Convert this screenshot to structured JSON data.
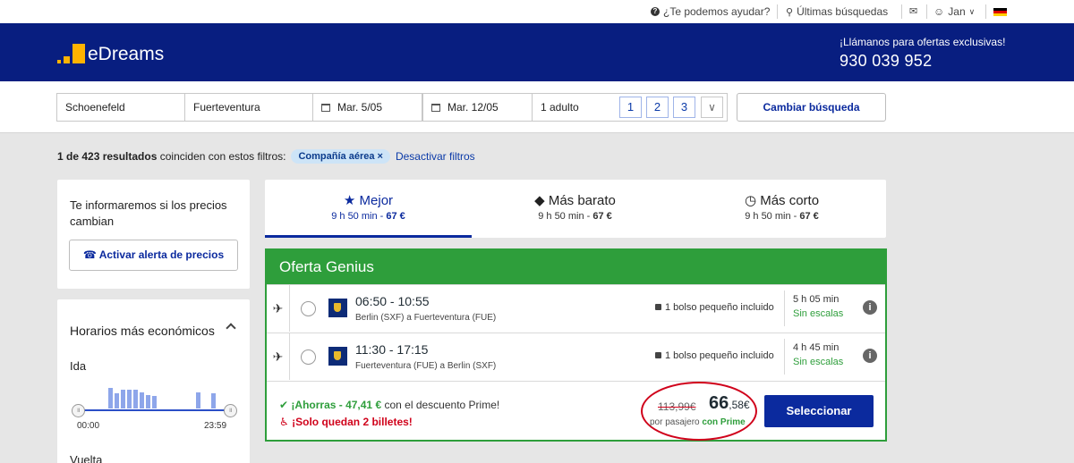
{
  "topbar": {
    "help": "¿Te podemos ayudar?",
    "recent": "Últimas búsquedas",
    "user": "Jan"
  },
  "header": {
    "logo_text": "eDreams",
    "call_line": "¡Llámanos para ofertas exclusivas!",
    "phone": "930 039 952"
  },
  "search": {
    "origin": "Schoenefeld",
    "destination": "Fuerteventura",
    "depart_date": "Mar. 5/05",
    "return_date": "Mar. 12/05",
    "passengers": "1 adulto",
    "pax_options": [
      "1",
      "2",
      "3"
    ],
    "change_button": "Cambiar búsqueda"
  },
  "filters": {
    "results_bold": "1 de 423 resultados",
    "results_rest": "coinciden con estos filtros:",
    "chip": "Compañía aérea",
    "chip_close": "×",
    "disable": "Desactivar filtros"
  },
  "sidebar": {
    "alert_title": "Te informaremos si los precios cambian",
    "alert_button": "Activar alerta de precios",
    "schedule_title": "Horarios más económicos",
    "ida": "Ida",
    "time_start": "00:00",
    "time_end": "23:59",
    "vuelta": "Vuelta"
  },
  "tabs": [
    {
      "icon": "★",
      "label": "Mejor",
      "sub_prefix": "9 h 50 min - ",
      "sub_price": "67 €"
    },
    {
      "icon": "◆",
      "label": "Más barato",
      "sub_prefix": "9 h 50 min - ",
      "sub_price": "67 €"
    },
    {
      "icon": "◷",
      "label": "Más corto",
      "sub_prefix": "9 h 50 min - ",
      "sub_price": "67 €"
    }
  ],
  "offer": {
    "title": "Oferta Genius",
    "legs": [
      {
        "times": "06:50 - 10:55",
        "route": "Berlin (SXF) a Fuerteventura (FUE)",
        "bag": "1 bolso pequeño incluido",
        "duration": "5 h 05 min",
        "stops": "Sin escalas"
      },
      {
        "times": "11:30 - 17:15",
        "route": "Fuerteventura (FUE) a Berlin (SXF)",
        "bag": "1 bolso pequeño incluido",
        "duration": "4 h 45 min",
        "stops": "Sin escalas"
      }
    ],
    "savings_prefix": "¡Ahorras - 47,41 €",
    "savings_suffix": "con el descuento Prime!",
    "few_left": "¡Solo quedan 2 billetes!",
    "old_price": "113,99€",
    "price_int": "66",
    "price_dec": ",58€",
    "per_pax": "por pasajero",
    "prime": "con Prime",
    "select_button": "Seleccionar"
  }
}
